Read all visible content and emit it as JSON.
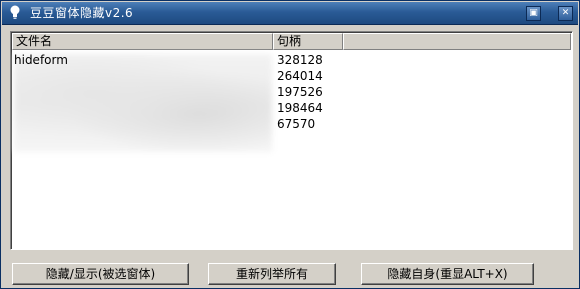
{
  "window": {
    "title": "豆豆窗体隐藏v2.6",
    "pin_glyph": "▣",
    "close_glyph": "✕"
  },
  "list": {
    "columns": [
      "文件名",
      "句柄",
      ""
    ],
    "rows": [
      {
        "name": "hideform",
        "handle": "328128"
      },
      {
        "name": "",
        "handle": "264014"
      },
      {
        "name": "",
        "handle": "197526"
      },
      {
        "name": "",
        "handle": "198464"
      },
      {
        "name": "",
        "handle": "67570"
      }
    ]
  },
  "buttons": {
    "toggle": "隐藏/显示(被选窗体)",
    "relist": "重新列举所有",
    "hide_self": "隐藏自身(重显ALT+X)"
  },
  "colors": {
    "titlebar": "#2a5b96",
    "face": "#d4d0c8",
    "list_bg": "#ffffff"
  }
}
